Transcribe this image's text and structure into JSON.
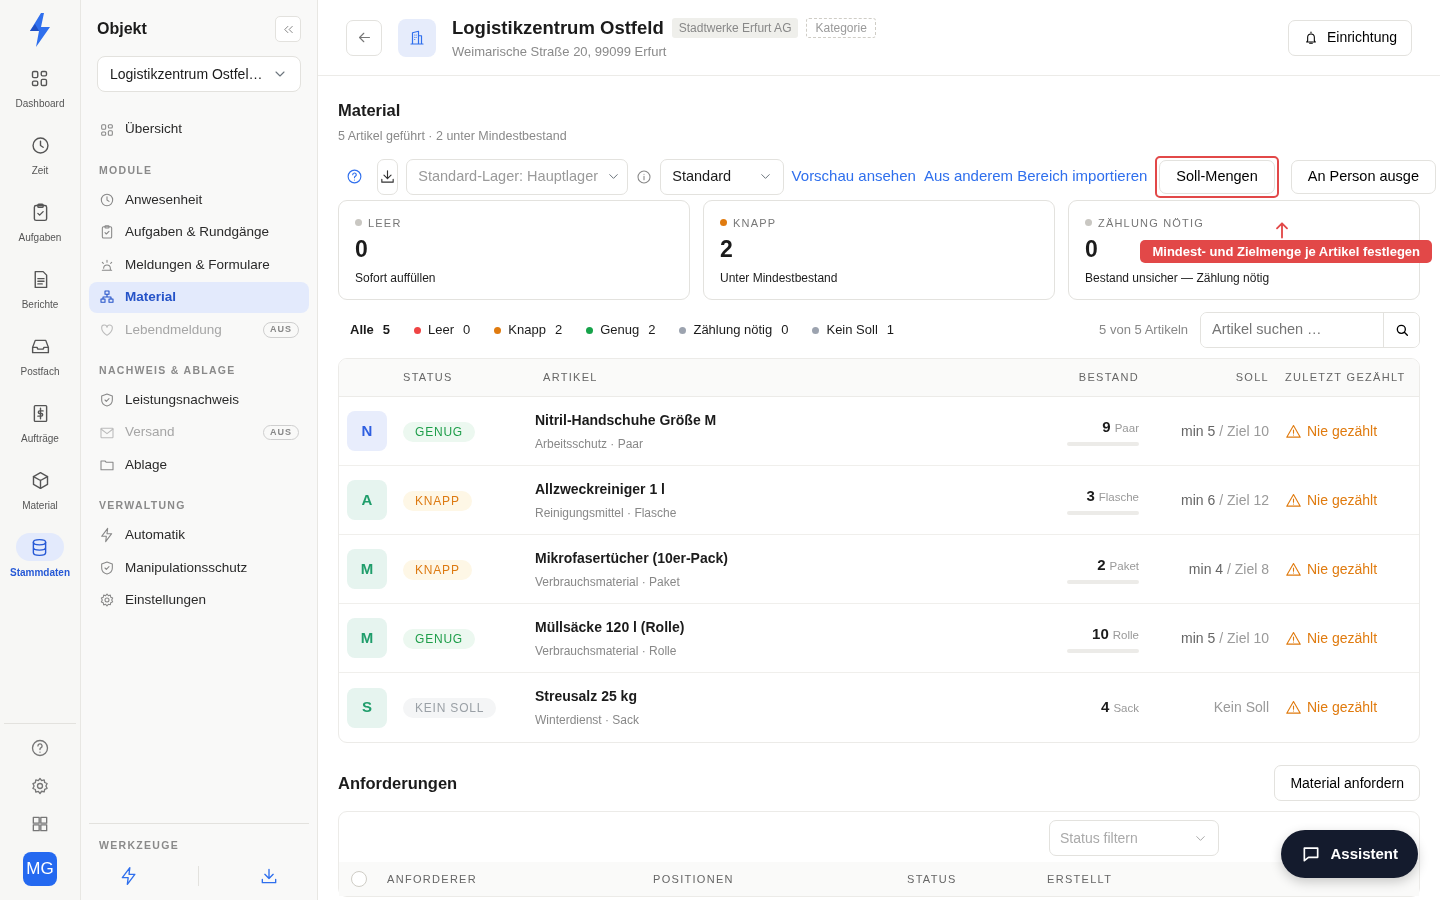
{
  "rail": {
    "items": [
      {
        "label": "Dashboard",
        "selected": false
      },
      {
        "label": "Zeit",
        "selected": false
      },
      {
        "label": "Aufgaben",
        "selected": false
      },
      {
        "label": "Berichte",
        "selected": false
      },
      {
        "label": "Postfach",
        "selected": false
      },
      {
        "label": "Aufträge",
        "selected": false
      },
      {
        "label": "Material",
        "selected": false
      },
      {
        "label": "Stammdaten",
        "selected": true
      }
    ],
    "avatar": "MG"
  },
  "sidebar": {
    "title": "Objekt",
    "object_select": "Logistikzentrum Ostfel…",
    "top_items": [
      {
        "label": "Übersicht",
        "selected": false,
        "disabled": false
      }
    ],
    "sections": [
      {
        "heading": "MODULE",
        "items": [
          {
            "label": "Anwesenheit",
            "selected": false,
            "disabled": false
          },
          {
            "label": "Aufgaben & Rundgänge",
            "selected": false,
            "disabled": false
          },
          {
            "label": "Meldungen & Formulare",
            "selected": false,
            "disabled": false
          },
          {
            "label": "Material",
            "selected": true,
            "disabled": false
          },
          {
            "label": "Lebendmeldung",
            "selected": false,
            "disabled": true,
            "badge": "AUS"
          }
        ]
      },
      {
        "heading": "NACHWEIS & ABLAGE",
        "items": [
          {
            "label": "Leistungsnachweis",
            "selected": false,
            "disabled": false
          },
          {
            "label": "Versand",
            "selected": false,
            "disabled": true,
            "badge": "AUS"
          },
          {
            "label": "Ablage",
            "selected": false,
            "disabled": false
          }
        ]
      },
      {
        "heading": "VERWALTUNG",
        "items": [
          {
            "label": "Automatik",
            "selected": false,
            "disabled": false
          },
          {
            "label": "Manipulationsschutz",
            "selected": false,
            "disabled": false
          },
          {
            "label": "Einstellungen",
            "selected": false,
            "disabled": false
          }
        ]
      }
    ],
    "tools_heading": "WERKZEUGE"
  },
  "header": {
    "title": "Logistikzentrum Ostfeld",
    "client_badge": "Stadtwerke Erfurt AG",
    "category_badge": "Kategorie",
    "address": "Weimarische Straße 20, 99099 Erfurt",
    "setup_button": "Einrichtung"
  },
  "material": {
    "title": "Material",
    "subtitle": "5 Artikel geführt · 2 unter Mindestbestand",
    "toolbar": {
      "storage_select": {
        "placeholder": "Standard-Lager: Hauptlager"
      },
      "view_select": {
        "value": "Standard"
      },
      "links": [
        "Vorschau ansehen",
        "Aus anderem Bereich importieren"
      ],
      "buttons": [
        {
          "label": "Soll-Mengen",
          "highlighted": true
        },
        {
          "label": "An Person ausge",
          "highlighted": false
        }
      ],
      "tooltip": "Mindest- und Zielmenge je Artikel festlegen"
    },
    "stats": [
      {
        "label": "LEER",
        "value": "0",
        "note": "Sofort auffüllen",
        "color": "#c9c7c2"
      },
      {
        "label": "KNAPP",
        "value": "2",
        "note": "Unter Mindestbestand",
        "color": "#e07b0f"
      },
      {
        "label": "ZÄHLUNG NÖTIG",
        "value": "0",
        "note": "Bestand unsicher — Zählung nötig",
        "color": "#c9c7c2"
      }
    ],
    "filters": [
      {
        "label": "Alle",
        "count": "5",
        "selected": true
      },
      {
        "label": "Leer",
        "count": "0",
        "selected": false,
        "color": "#ef4444"
      },
      {
        "label": "Knapp",
        "count": "2",
        "selected": false,
        "color": "#e07b0f"
      },
      {
        "label": "Genug",
        "count": "2",
        "selected": false,
        "color": "#16a34a"
      },
      {
        "label": "Zählung nötig",
        "count": "0",
        "selected": false,
        "color": "#9ca3af"
      },
      {
        "label": "Kein Soll",
        "count": "1",
        "selected": false,
        "color": "#9ca3af"
      }
    ],
    "result_count": "5 von 5 Artikeln",
    "search": {
      "placeholder": "Artikel suchen …"
    },
    "table": {
      "columns": [
        "STATUS",
        "ARTIKEL",
        "BESTAND",
        "SOLL",
        "ZULETZT GEZÄHLT"
      ],
      "rows": [
        {
          "initial": "N",
          "color": "#2f5fe0",
          "status": "GENUG",
          "kind": "genug",
          "name": "Nitril-Handschuhe Größe M",
          "meta": "Arbeitsschutz · Paar",
          "count": "9",
          "unit": "Paar",
          "stock_bar": true,
          "soll_min": "min 5",
          "soll_target": "/ Ziel 10",
          "last_counted": "Nie gezählt"
        },
        {
          "initial": "A",
          "color": "#1f9d6b",
          "status": "KNAPP",
          "kind": "knapp",
          "name": "Allzweckreiniger 1 l",
          "meta": "Reinigungsmittel · Flasche",
          "count": "3",
          "unit": "Flasche",
          "stock_bar": true,
          "soll_min": "min 6",
          "soll_target": "/ Ziel 12",
          "last_counted": "Nie gezählt"
        },
        {
          "initial": "M",
          "color": "#1f9d6b",
          "status": "KNAPP",
          "kind": "knapp",
          "name": "Mikrofasertücher (10er-Pack)",
          "meta": "Verbrauchsmaterial · Paket",
          "count": "2",
          "unit": "Paket",
          "stock_bar": true,
          "soll_min": "min 4",
          "soll_target": "/ Ziel 8",
          "last_counted": "Nie gezählt"
        },
        {
          "initial": "M",
          "color": "#1f9d6b",
          "status": "GENUG",
          "kind": "genug",
          "name": "Müllsäcke 120 l (Rolle)",
          "meta": "Verbrauchsmaterial · Rolle",
          "count": "10",
          "unit": "Rolle",
          "stock_bar": true,
          "soll_min": "min 5",
          "soll_target": "/ Ziel 10",
          "last_counted": "Nie gezählt"
        },
        {
          "initial": "S",
          "color": "#1f9d6b",
          "status": "KEIN SOLL",
          "kind": "kein_soll",
          "name": "Streusalz 25 kg",
          "meta": "Winterdienst · Sack",
          "count": "4",
          "unit": "Sack",
          "stock_bar": false,
          "soll_none": "Kein Soll",
          "last_counted": "Nie gezählt"
        }
      ]
    }
  },
  "requests": {
    "title": "Anforderungen",
    "button": "Material anfordern",
    "status_filter": {
      "placeholder": "Status filtern"
    },
    "select_all_checked": false,
    "columns": [
      "ANFORDERER",
      "POSITIONEN",
      "STATUS",
      "ERSTELLT"
    ]
  },
  "assistant_button": "Assistent"
}
